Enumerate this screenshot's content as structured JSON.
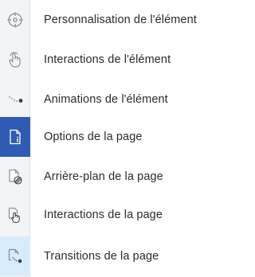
{
  "menu": {
    "items": [
      {
        "label": "Personnalisation de l'élément",
        "icon": "crosshair-icon"
      },
      {
        "label": "Interactions de l'élément",
        "icon": "hand-pointer-icon"
      },
      {
        "label": "Animations de l'élément",
        "icon": "motion-path-icon"
      },
      {
        "label": "Options de la page",
        "icon": "page-info-icon",
        "state": "active"
      },
      {
        "label": "Arrière-plan de la page",
        "icon": "page-background-icon"
      },
      {
        "label": "Interactions de la page",
        "icon": "page-hand-icon"
      },
      {
        "label": "Transitions de la page",
        "icon": "page-transition-icon",
        "state": "hover"
      }
    ]
  },
  "colors": {
    "active_bg": "#2f5bb3",
    "hover_bg": "#d8ebfa",
    "rail_bg": "#f3f4f5",
    "text": "#2b2b2b",
    "icon": "#8a8f94"
  }
}
